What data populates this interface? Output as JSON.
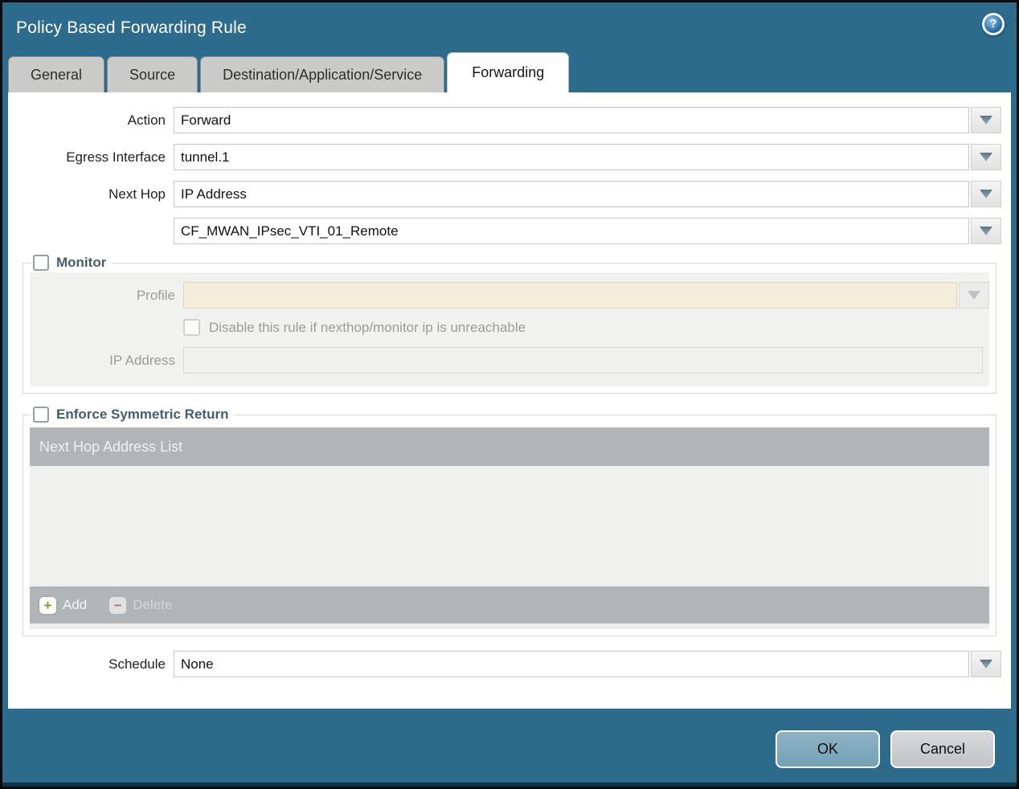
{
  "dialog": {
    "title": "Policy Based Forwarding Rule"
  },
  "icons": {
    "help": "?",
    "add_glyph": "+",
    "delete_glyph": "−",
    "dropdown": "chevron-down"
  },
  "tabs": {
    "general": "General",
    "source": "Source",
    "destination": "Destination/Application/Service",
    "forwarding": "Forwarding",
    "active_tab": "Forwarding"
  },
  "form": {
    "action": {
      "label": "Action",
      "value": "Forward"
    },
    "egress_interface": {
      "label": "Egress Interface",
      "value": "tunnel.1"
    },
    "next_hop": {
      "label": "Next Hop",
      "value": "IP Address"
    },
    "next_hop_address": {
      "value": "CF_MWAN_IPsec_VTI_01_Remote"
    },
    "schedule": {
      "label": "Schedule",
      "value": "None"
    }
  },
  "monitor": {
    "legend": "Monitor",
    "checked": false,
    "enabled": false,
    "profile": {
      "label": "Profile",
      "value": ""
    },
    "disable_rule": {
      "label": "Disable this rule if nexthop/monitor ip is unreachable",
      "checked": false
    },
    "ip_address": {
      "label": "IP Address",
      "value": ""
    }
  },
  "symmetric_return": {
    "legend": "Enforce Symmetric Return",
    "checked": false,
    "table": {
      "header": "Next Hop Address List",
      "rows": []
    },
    "toolbar": {
      "add_label": "Add",
      "delete_label": "Delete",
      "add_enabled": true,
      "delete_enabled": false
    }
  },
  "footer": {
    "ok_label": "OK",
    "cancel_label": "Cancel"
  },
  "colors": {
    "titlebar_teal": "#2d6b8c",
    "active_tab_bg": "#ffffff",
    "inactive_tab_bg": "#cacac9",
    "legend_text": "#425d6b",
    "profile_field_bg": "#f3edda",
    "table_header_bg": "#b2b5b8",
    "add_icon_green": "#7f9a33",
    "delete_icon_red": "#b0786d",
    "ok_button_bg": "#7ba7bc",
    "cancel_button_bg": "#c9cbcd"
  }
}
